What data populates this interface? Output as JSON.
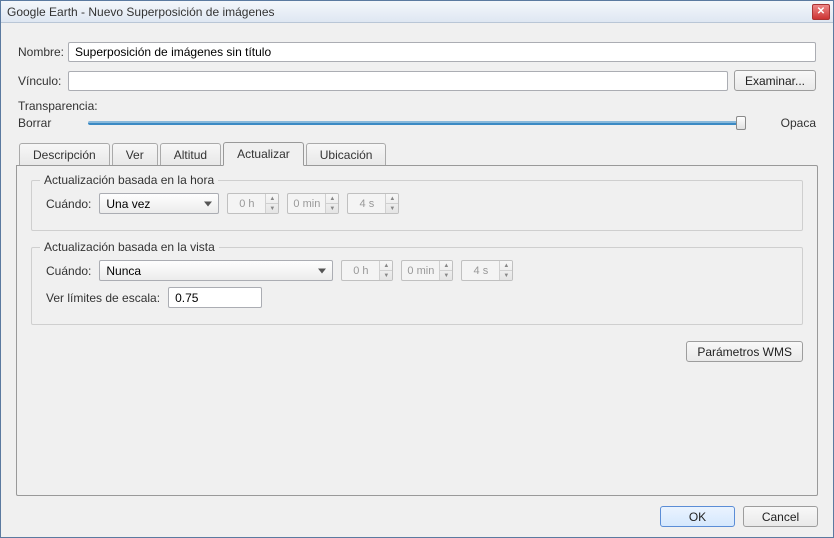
{
  "window": {
    "title": "Google Earth - Nuevo Superposición de imágenes"
  },
  "labels": {
    "name": "Nombre:",
    "link": "Vínculo:",
    "browse": "Examinar...",
    "transparency": "Transparencia:",
    "clear": "Borrar",
    "opaque": "Opaca"
  },
  "fields": {
    "name_value": "Superposición de imágenes sin título",
    "link_value": ""
  },
  "tabs": {
    "descripcion": "Descripción",
    "ver": "Ver",
    "altitud": "Altitud",
    "actualizar": "Actualizar",
    "ubicacion": "Ubicación"
  },
  "refresh": {
    "time_group": "Actualización basada en la hora",
    "view_group": "Actualización basada en la vista",
    "when": "Cuándo:",
    "time_mode": "Una vez",
    "view_mode": "Nunca",
    "h": "0 h",
    "m": "0 min",
    "s": "4 s",
    "view_h": "0 h",
    "view_m": "0 min",
    "view_s": "4 s",
    "scale_label": "Ver límites de escala:",
    "scale_value": "0.75",
    "wms": "Parámetros WMS"
  },
  "footer": {
    "ok": "OK",
    "cancel": "Cancel"
  }
}
